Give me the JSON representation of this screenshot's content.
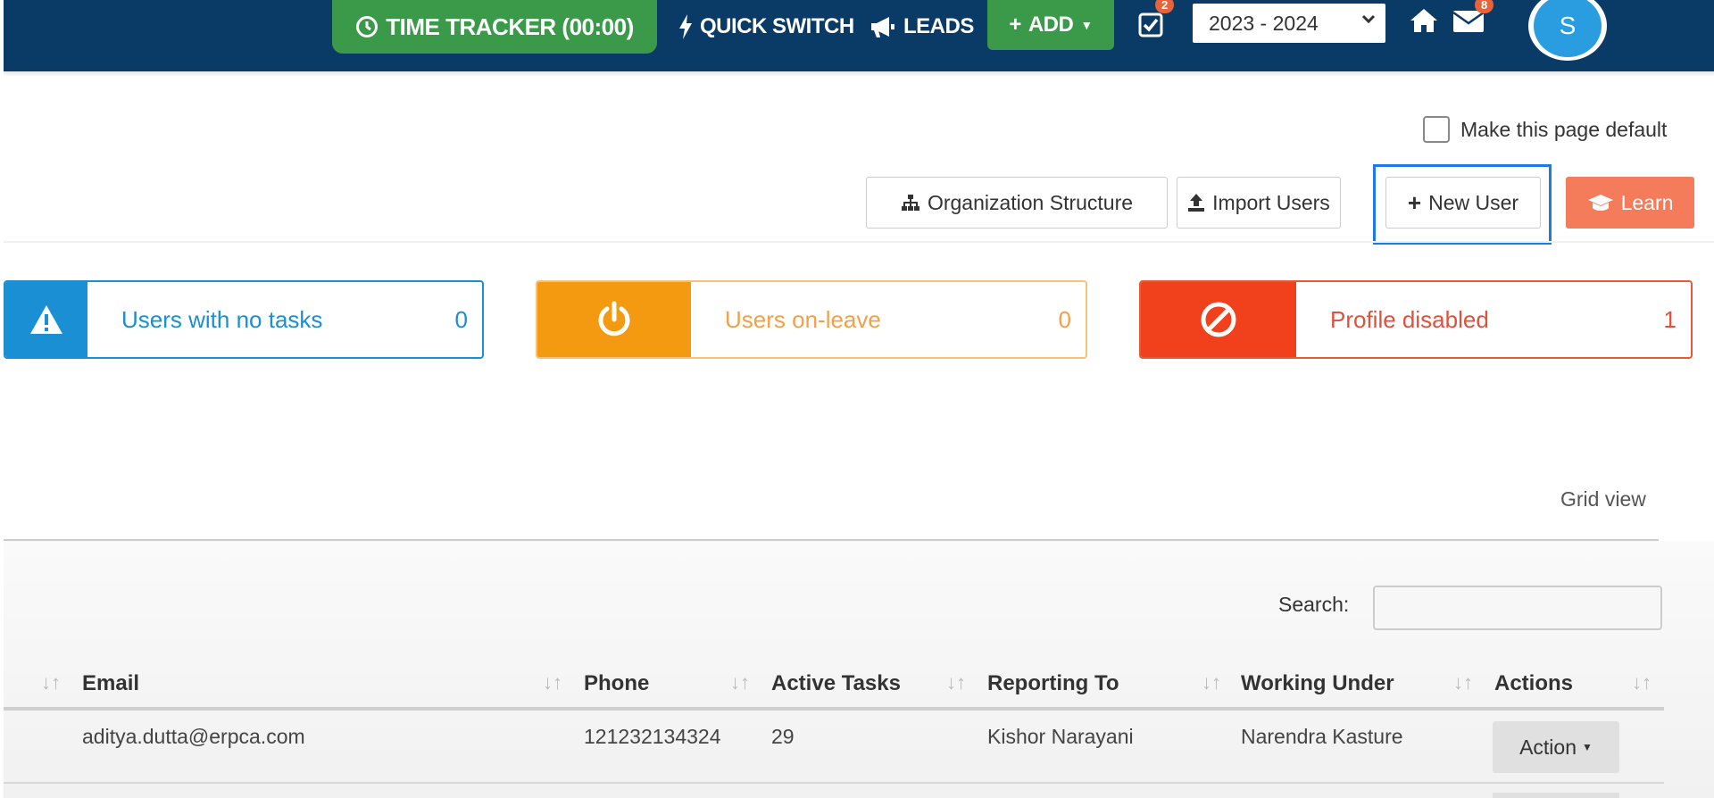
{
  "navbar": {
    "time_tracker": "TIME TRACKER (00:00)",
    "quick_switch": "QUICK SWITCH",
    "leads": "LEADS",
    "add": "ADD",
    "tasks_badge": "2",
    "year": "2023 - 2024",
    "mail_badge": "8",
    "avatar_initial": "S",
    "colors": {
      "bg": "#0a3a66",
      "green": "#3a9a4a",
      "badge": "#e9633a",
      "avatar": "#2a9de0"
    }
  },
  "page_options": {
    "make_default_label": "Make this page default"
  },
  "toolbar": {
    "org_structure": "Organization Structure",
    "import_users": "Import Users",
    "new_user": "New User",
    "learn": "Learn"
  },
  "stats": [
    {
      "label": "Users with no tasks",
      "count": "0",
      "icon": "warning-icon",
      "color": "#1a8fd4"
    },
    {
      "label": "Users on-leave",
      "count": "0",
      "icon": "power-icon",
      "color": "#f39a10"
    },
    {
      "label": "Profile disabled",
      "count": "1",
      "icon": "ban-icon",
      "color": "#f0401c"
    }
  ],
  "view_toggle": "Grid view",
  "search": {
    "label": "Search:",
    "value": ""
  },
  "table": {
    "columns": [
      "Email",
      "Phone",
      "Active Tasks",
      "Reporting To",
      "Working Under",
      "Actions"
    ],
    "rows": [
      {
        "email": "aditya.dutta@erpca.com",
        "phone": "121232134324",
        "active_tasks": "29",
        "reporting_to": "Kishor Narayani",
        "working_under": "Narendra Kasture",
        "action": "Action"
      }
    ]
  }
}
